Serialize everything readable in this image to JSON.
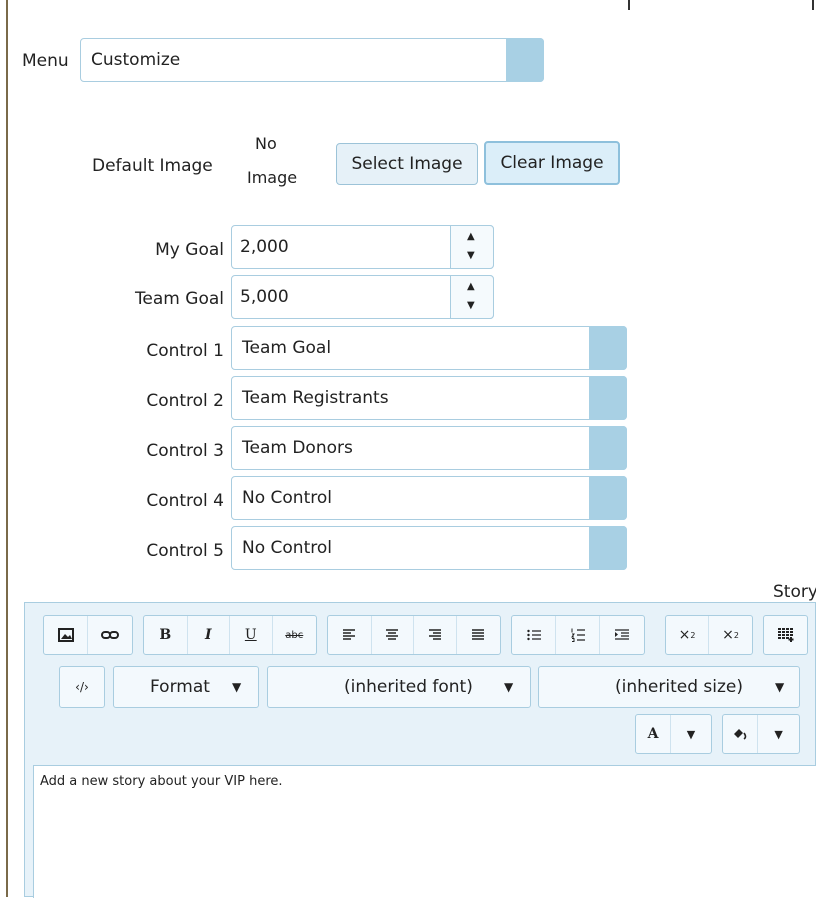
{
  "menu": {
    "label": "Menu",
    "value": "Customize"
  },
  "default_image": {
    "label": "Default Image",
    "status_line1": "No",
    "status_line2": "Image",
    "select_button": "Select Image",
    "clear_button": "Clear Image"
  },
  "goals": {
    "my_goal_label": "My Goal",
    "my_goal_value": "2,000",
    "team_goal_label": "Team Goal",
    "team_goal_value": "5,000"
  },
  "controls": [
    {
      "label": "Control 1",
      "value": "Team Goal"
    },
    {
      "label": "Control 2",
      "value": "Team Registrants"
    },
    {
      "label": "Control 3",
      "value": "Team Donors"
    },
    {
      "label": "Control 4",
      "value": "No Control"
    },
    {
      "label": "Control 5",
      "value": "No Control"
    }
  ],
  "story": {
    "label": "Story",
    "format_select": "Format",
    "font_select": "(inherited font)",
    "size_select": "(inherited size)",
    "content": "Add a new story about your VIP here."
  },
  "icons": {
    "image": "image-icon",
    "link": "link-icon",
    "bold": "bold-icon",
    "italic": "italic-icon",
    "underline": "underline-icon",
    "strikethrough": "strikethrough-icon",
    "align_left": "align-left-icon",
    "align_center": "align-center-icon",
    "align_right": "align-right-icon",
    "justify": "justify-icon",
    "bullets": "bullet-list-icon",
    "numbers": "numbered-list-icon",
    "indent": "indent-icon",
    "subscript": "subscript-icon",
    "superscript": "superscript-icon",
    "table": "table-icon",
    "html": "view-html-icon",
    "font_color": "font-color-icon",
    "highlight": "highlight-color-icon"
  },
  "colors": {
    "accent": "#a8d0e4",
    "border": "#a9cde0",
    "button_bg": "#e6f1f8",
    "toolbar_bg": "#e7f2f9"
  }
}
